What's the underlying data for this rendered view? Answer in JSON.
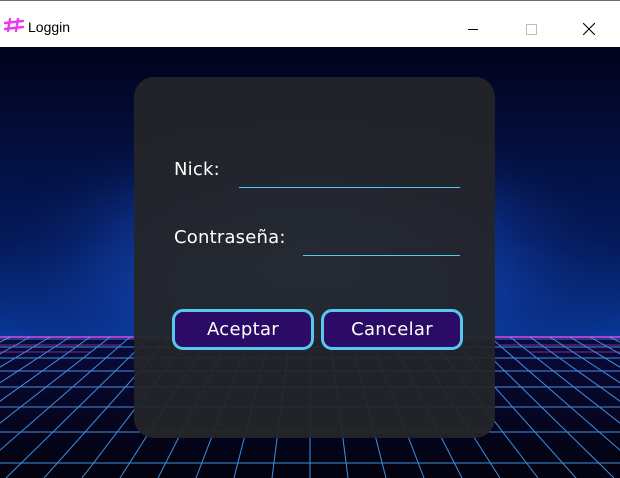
{
  "window": {
    "title": "Loggin",
    "icon": "hash-icon",
    "controls": {
      "minimize": "minimize-icon",
      "maximize": "maximize-icon",
      "close": "close-icon"
    }
  },
  "form": {
    "nick_label": "Nick:",
    "nick_value": "",
    "password_label": "Contraseña:",
    "password_value": ""
  },
  "actions": {
    "accept_label": "Aceptar",
    "cancel_label": "Cancelar"
  },
  "colors": {
    "accent": "#55c8f0",
    "button_fill": "#2b0b66",
    "panel": "#242528",
    "app_icon": "#e83cf0"
  }
}
